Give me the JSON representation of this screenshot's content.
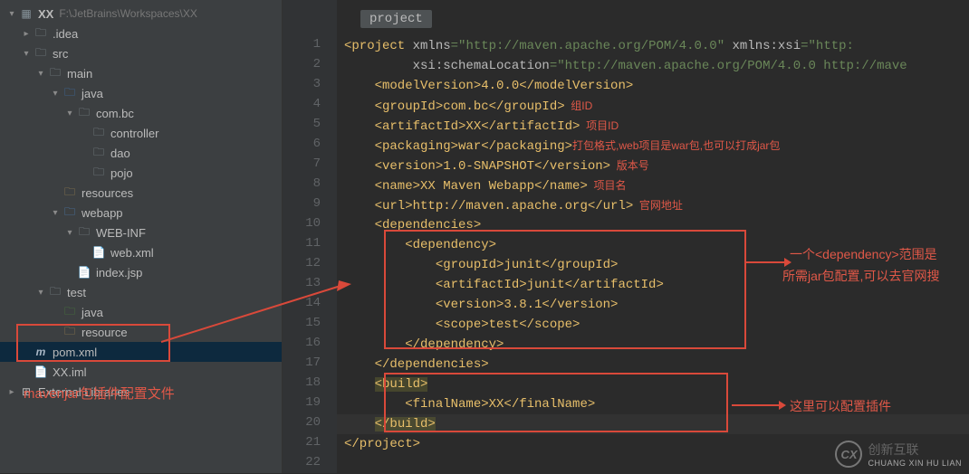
{
  "breadcrumb": "project",
  "path_bar": {
    "project_icon": "XX",
    "path": "F:\\JetBrains\\Workspaces\\XX"
  },
  "tree": {
    "idea": ".idea",
    "src": "src",
    "main": "main",
    "java": "java",
    "combc": "com.bc",
    "controller": "controller",
    "dao": "dao",
    "pojo": "pojo",
    "resources": "resources",
    "webapp": "webapp",
    "webinf": "WEB-INF",
    "webxml": "web.xml",
    "indexjsp": "index.jsp",
    "test": "test",
    "test_java": "java",
    "test_resource": "resource",
    "pom": "pom.xml",
    "xximl": "XX.iml",
    "extlib": "External Libraries"
  },
  "gutter": [
    "1",
    "2",
    "3",
    "4",
    "5",
    "6",
    "7",
    "8",
    "9",
    "10",
    "11",
    "12",
    "13",
    "14",
    "15",
    "16",
    "17",
    "18",
    "19",
    "20",
    "21",
    "22"
  ],
  "code": {
    "l1_pre": "<project ",
    "l1_attr1n": "xmlns",
    "l1_attr1v": "=\"http://maven.apache.org/POM/4.0.0\"",
    "l1_attr2n": " xmlns:xsi",
    "l1_attr2v": "=\"http:",
    "l2_attr_n": "         xsi:schemaLocation",
    "l2_attr_v": "=\"http://maven.apache.org/POM/4.0.0 http://mave",
    "l3": "    <modelVersion>4.0.0</modelVersion>",
    "l4_a": "    <groupId>com.bc</groupId>",
    "l4_c": "  组ID",
    "l5_a": "    <artifactId>XX</artifactId>",
    "l5_c": "  项目ID",
    "l6_a": "    <packaging>war</packaging>",
    "l6_c": "打包格式,web项目是war包,也可以打成jar包",
    "l7_a": "    <version>1.0-SNAPSHOT</version>",
    "l7_c": "  版本号",
    "l8_a": "    <name>XX Maven Webapp</name>",
    "l8_c": "  项目名",
    "l9_a": "    <url>http://maven.apache.org</url>",
    "l9_c": "  官网地址",
    "l10": "    <dependencies>",
    "l11": "        <dependency>",
    "l12": "            <groupId>junit</groupId>",
    "l13": "            <artifactId>junit</artifactId>",
    "l14": "            <version>3.8.1</version>",
    "l15": "            <scope>test</scope>",
    "l16": "        </dependency>",
    "l17": "    </dependencies>",
    "l18_a": "    ",
    "l18_b": "<build>",
    "l19": "        <finalName>XX</finalName>",
    "l20_a": "    ",
    "l20_b": "</build>",
    "l21": "</project>"
  },
  "annotations": {
    "sidebar": "mavenjar包插件配置文件",
    "dep1": "一个<dependency>范围是",
    "dep2": "所需jar包配置,可以去官网搜",
    "build": "这里可以配置插件"
  },
  "watermark": {
    "cn": "创新互联",
    "en": "CHUANG XIN HU LIAN"
  }
}
